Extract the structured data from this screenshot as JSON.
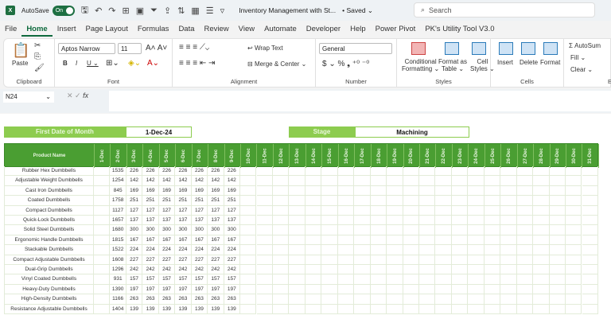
{
  "titlebar": {
    "autosave_label": "AutoSave",
    "toggle_label": "On",
    "doc_title": "Inventory Management with St...",
    "saved": "• Saved ⌄",
    "search_placeholder": "Search"
  },
  "menu": [
    "File",
    "Home",
    "Insert",
    "Page Layout",
    "Formulas",
    "Data",
    "Review",
    "View",
    "Automate",
    "Developer",
    "Help",
    "Power Pivot",
    "PK's Utility Tool V3.0"
  ],
  "ribbon": {
    "paste": "Paste",
    "clipboard": "Clipboard",
    "font_name": "Aptos Narrow",
    "font_size": "11",
    "font": "Font",
    "wrap_text": "Wrap Text",
    "merge_center": "Merge & Center",
    "alignment": "Alignment",
    "number_format": "General",
    "number": "Number",
    "conditional": "Conditional",
    "formatting": "Formatting ⌄",
    "format_as": "Format as",
    "table": "Table ⌄",
    "cell": "Cell",
    "styles_btn": "Styles ⌄",
    "styles": "Styles",
    "insert": "Insert",
    "delete": "Delete",
    "format": "Format",
    "cells": "Cells",
    "autosum": "Σ AutoSum",
    "fill": "Fill ⌄",
    "clear": "Clear ⌄",
    "editing": "E"
  },
  "formula_bar": {
    "name_box": "N24",
    "fx": "fx",
    "value": ""
  },
  "sheet": {
    "first_date_label": "First Date of Month",
    "first_date_value": "1-Dec-24",
    "stage_label": "Stage",
    "stage_value": "Machining",
    "header_product": "Product Name",
    "dates": [
      "1-Dec",
      "2-Dec",
      "3-Dec",
      "4-Dec",
      "5-Dec",
      "6-Dec",
      "7-Dec",
      "8-Dec",
      "9-Dec",
      "10-Dec",
      "11-Dec",
      "12-Dec",
      "13-Dec",
      "14-Dec",
      "15-Dec",
      "16-Dec",
      "17-Dec",
      "18-Dec",
      "19-Dec",
      "20-Dec",
      "21-Dec",
      "22-Dec",
      "23-Dec",
      "24-Dec",
      "25-Dec",
      "26-Dec",
      "27-Dec",
      "28-Dec",
      "29-Dec",
      "30-Dec",
      "31-Dec"
    ],
    "rows": [
      {
        "product": "Rubber Hex Dumbbells",
        "values": [
          "",
          "1535",
          "226",
          "226",
          "226",
          "226",
          "226",
          "226",
          "226"
        ]
      },
      {
        "product": "Adjustable Weight Dumbbells",
        "values": [
          "",
          "1254",
          "142",
          "142",
          "142",
          "142",
          "142",
          "142",
          "142"
        ]
      },
      {
        "product": "Cast Iron Dumbbells",
        "values": [
          "",
          "845",
          "169",
          "169",
          "169",
          "169",
          "169",
          "169",
          "169"
        ]
      },
      {
        "product": "Coated Dumbbells",
        "values": [
          "",
          "1758",
          "251",
          "251",
          "251",
          "251",
          "251",
          "251",
          "251"
        ]
      },
      {
        "product": "Compact Dumbbells",
        "values": [
          "",
          "1127",
          "127",
          "127",
          "127",
          "127",
          "127",
          "127",
          "127"
        ]
      },
      {
        "product": "Quick-Lock Dumbbells",
        "values": [
          "",
          "1657",
          "137",
          "137",
          "137",
          "137",
          "137",
          "137",
          "137"
        ]
      },
      {
        "product": "Solid Steel Dumbbells",
        "values": [
          "",
          "1680",
          "300",
          "300",
          "300",
          "300",
          "300",
          "300",
          "300"
        ]
      },
      {
        "product": "Ergonomic Handle Dumbbells",
        "values": [
          "",
          "1815",
          "167",
          "167",
          "167",
          "167",
          "167",
          "167",
          "167"
        ]
      },
      {
        "product": "Stackable Dumbbells",
        "values": [
          "",
          "1522",
          "224",
          "224",
          "224",
          "224",
          "224",
          "224",
          "224"
        ]
      },
      {
        "product": "Compact Adjustable Dumbbells",
        "values": [
          "",
          "1608",
          "227",
          "227",
          "227",
          "227",
          "227",
          "227",
          "227"
        ]
      },
      {
        "product": "Dual-Grip Dumbbells",
        "values": [
          "",
          "1296",
          "242",
          "242",
          "242",
          "242",
          "242",
          "242",
          "242"
        ]
      },
      {
        "product": "Vinyl Coated Dumbbells",
        "values": [
          "",
          "931",
          "157",
          "157",
          "157",
          "157",
          "157",
          "157",
          "157"
        ]
      },
      {
        "product": "Heavy-Duty Dumbbells",
        "values": [
          "",
          "1390",
          "197",
          "197",
          "197",
          "197",
          "197",
          "197",
          "197"
        ]
      },
      {
        "product": "High-Density Dumbbells",
        "values": [
          "",
          "1166",
          "263",
          "263",
          "263",
          "263",
          "263",
          "263",
          "263"
        ]
      },
      {
        "product": "Resistance Adjustable Dumbbells",
        "values": [
          "",
          "1404",
          "139",
          "139",
          "139",
          "139",
          "139",
          "139",
          "139"
        ]
      }
    ]
  },
  "colors": {
    "header_green": "#4a9e32",
    "label_green": "#8dcc4f",
    "excel_green": "#1d6f42"
  }
}
